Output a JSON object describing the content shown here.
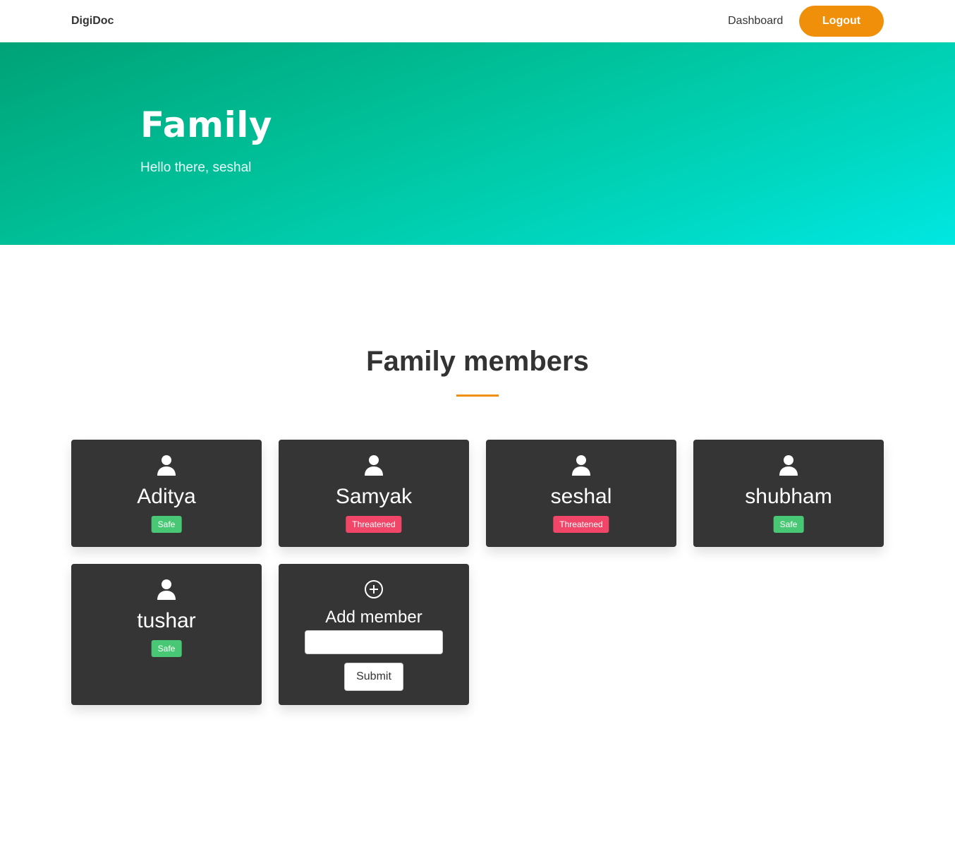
{
  "navbar": {
    "brand": "DigiDoc",
    "dashboard_label": "Dashboard",
    "logout_label": "Logout"
  },
  "hero": {
    "title": "Family",
    "subtitle": "Hello there, seshal"
  },
  "section": {
    "title": "Family members"
  },
  "members": [
    {
      "name": "Aditya",
      "status": "Safe",
      "status_color": "#48c774",
      "icon": "user-icon"
    },
    {
      "name": "Samyak",
      "status": "Threatened",
      "status_color": "#f14668",
      "icon": "user-icon"
    },
    {
      "name": "seshal",
      "status": "Threatened",
      "status_color": "#f14668",
      "icon": "user-icon"
    },
    {
      "name": "shubham",
      "status": "Safe",
      "status_color": "#48c774",
      "icon": "user-icon"
    },
    {
      "name": "tushar",
      "status": "Safe",
      "status_color": "#48c774",
      "icon": "user-icon"
    }
  ],
  "add_member": {
    "icon": "plus-circle-icon",
    "label": "Add member",
    "input_value": "",
    "submit_label": "Submit"
  },
  "colors": {
    "accent": "#f0900a",
    "card_bg": "#353535",
    "hero_gradient_start": "#00a276",
    "hero_gradient_end": "#00e7e2"
  }
}
